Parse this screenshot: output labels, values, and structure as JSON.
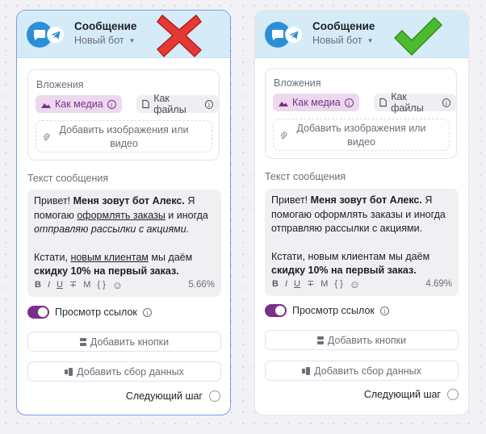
{
  "cards": [
    {
      "header": {
        "title": "Сообщение",
        "bot_name": "Новый бот",
        "avatar_icon": "chat-bubble-icon",
        "channel_icon": "telegram-icon"
      },
      "verdict_icon": "red-cross-icon",
      "attachments": {
        "label": "Вложения",
        "as_media": "Как медиа",
        "as_files": "Как файлы",
        "add_text_line1": "Добавить изображения или",
        "add_text_line2": "видео"
      },
      "text_label": "Текст сообщения",
      "message": {
        "p1_a": "Привет! ",
        "p1_b": "Меня зовут бот Алекс.",
        "p1_c": " Я помогаю ",
        "p1_d": "оформлять заказы",
        "p1_e": " и иногда ",
        "p1_f": "отправляю рассылки с акциями.",
        "p2_a": "Кстати, ",
        "p2_b": "новым клиентам",
        "p2_c": " мы даём ",
        "p2_d": "скидку 10% на первый заказ."
      },
      "toolbar": {
        "bold": "B",
        "italic": "I",
        "underline": "U",
        "strike": "∓",
        "mono": "M",
        "code": "{ }",
        "emoji": "☺"
      },
      "percent": "5.66%",
      "link_preview": "Просмотр ссылок",
      "add_buttons": "Добавить кнопки",
      "add_data": "Добавить сбор данных",
      "next_step": "Следующий шаг"
    },
    {
      "header": {
        "title": "Сообщение",
        "bot_name": "Новый бот",
        "avatar_icon": "chat-bubble-icon",
        "channel_icon": "telegram-icon"
      },
      "verdict_icon": "green-check-icon",
      "attachments": {
        "label": "Вложения",
        "as_media": "Как медиа",
        "as_files": "Как файлы",
        "add_text_line1": "Добавить изображения или",
        "add_text_line2": "видео"
      },
      "text_label": "Текст сообщения",
      "message": {
        "p1_a": "Привет! ",
        "p1_b": "Меня зовут бот Алекс.",
        "p1_c": " Я помогаю ",
        "p1_d": "оформлять заказы",
        "p1_e": " и иногда отправляю рассылки с акциями.",
        "p2_a": "Кстати, новым клиентам мы даём ",
        "p2_b": "скидку 10% на первый заказ."
      },
      "toolbar": {
        "bold": "B",
        "italic": "I",
        "underline": "U",
        "strike": "∓",
        "mono": "M",
        "code": "{ }",
        "emoji": "☺"
      },
      "percent": "4.69%",
      "link_preview": "Просмотр ссылок",
      "add_buttons": "Добавить кнопки",
      "add_data": "Добавить сбор данных",
      "next_step": "Следующий шаг"
    }
  ],
  "colors": {
    "accent": "#7a2f8a",
    "header_bg": "#d5ebf7",
    "avatar_blue": "#2c8fd6",
    "pill_media_bg": "#ecd9ee",
    "selected_border": "#7d9be6",
    "cross_red": "#e53935",
    "check_green": "#4cbb2e"
  }
}
